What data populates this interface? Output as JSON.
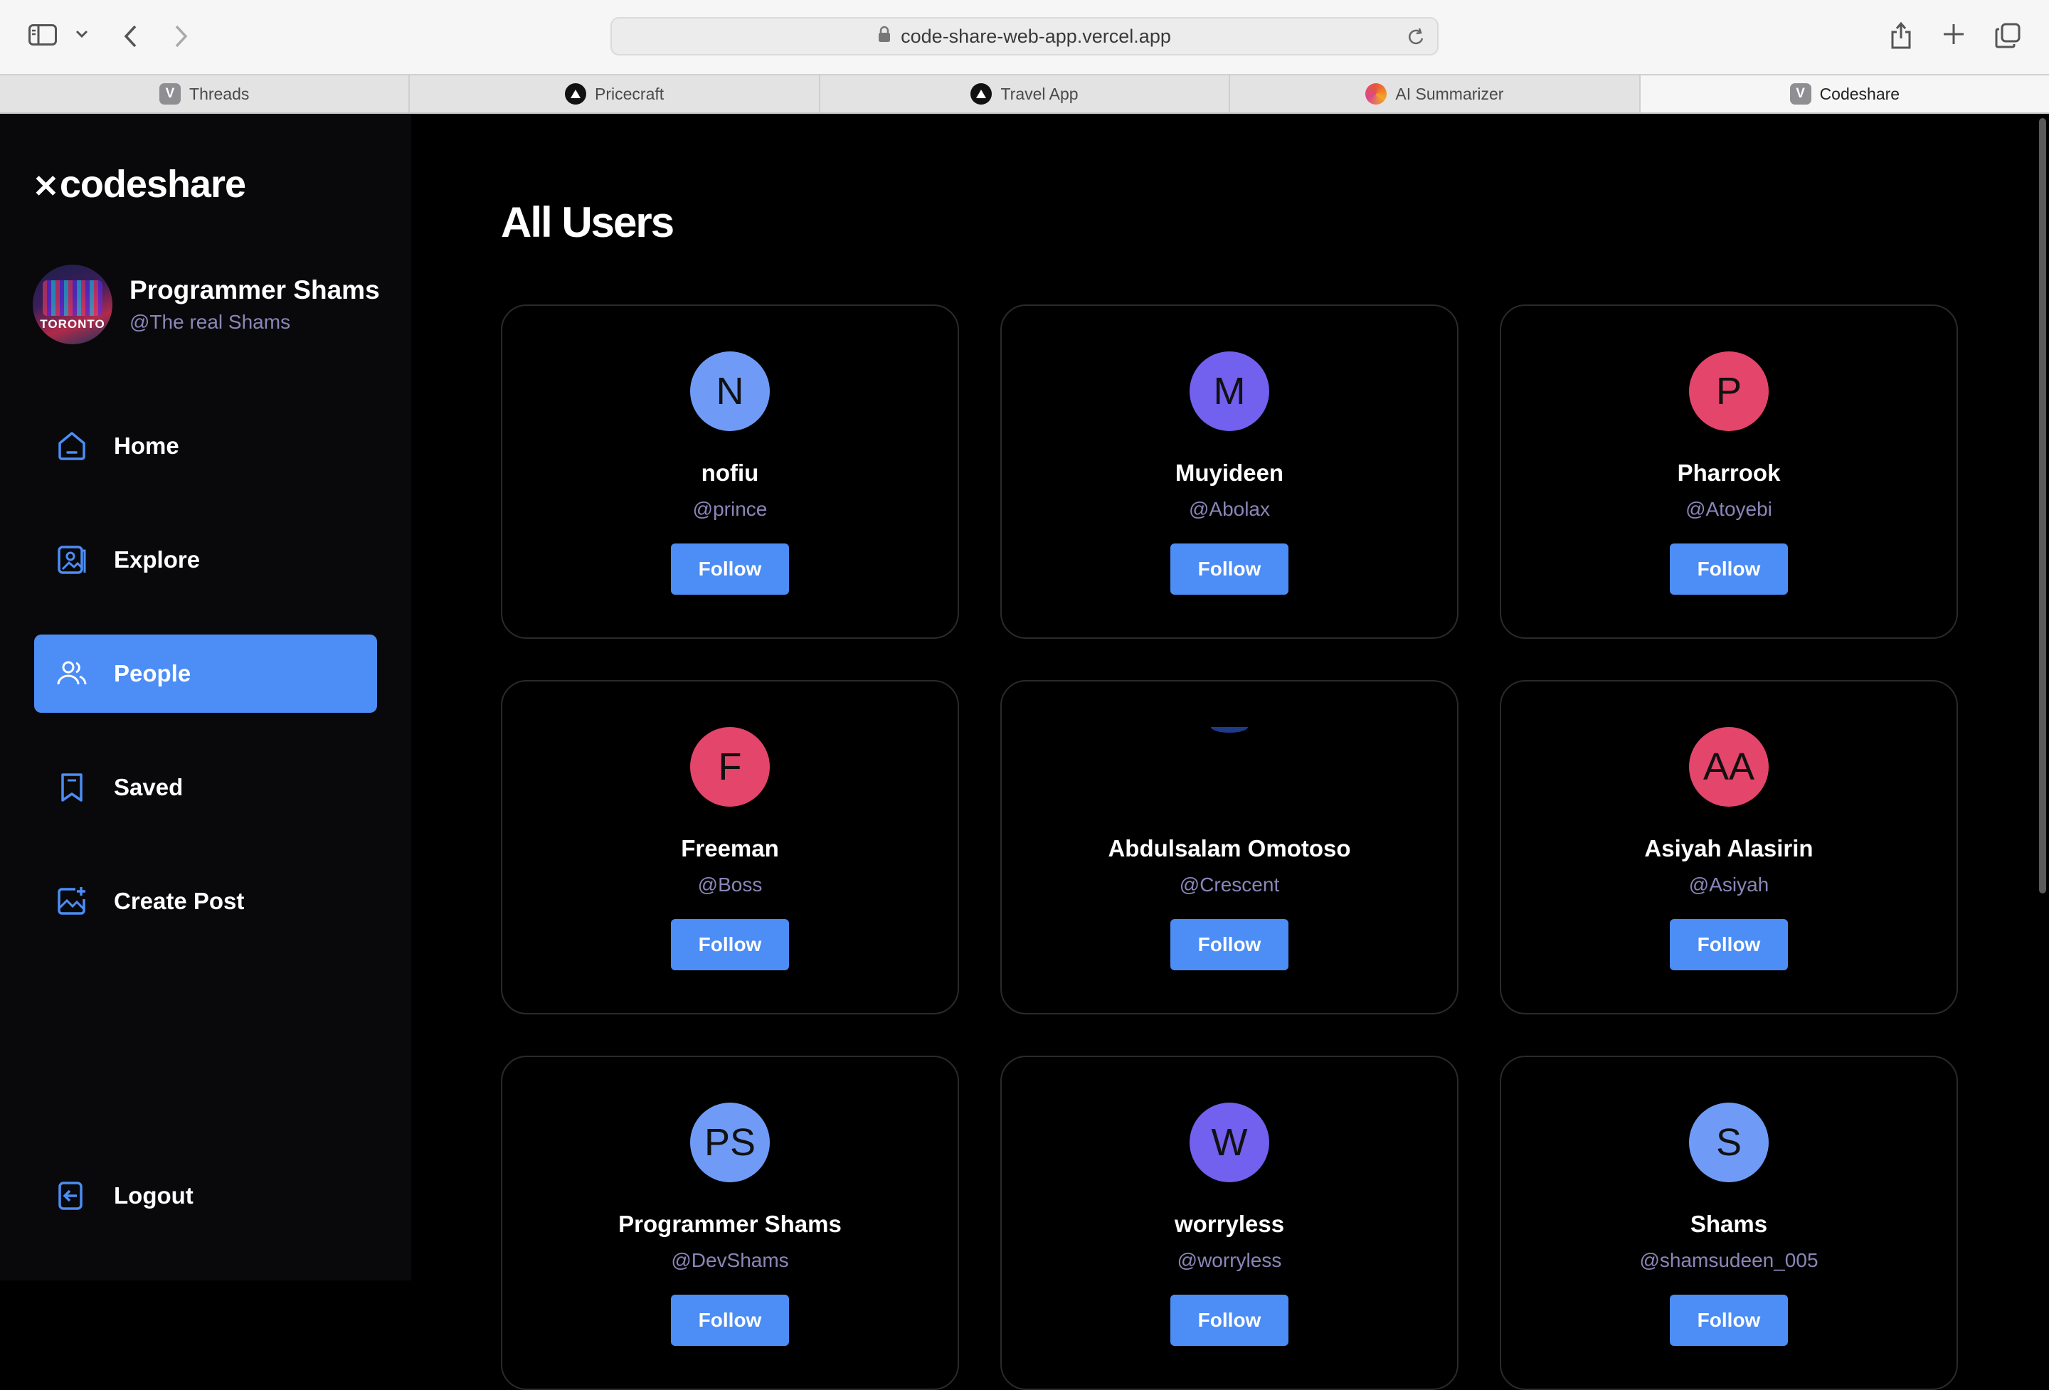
{
  "browser": {
    "url": "code-share-web-app.vercel.app",
    "tabs": [
      {
        "label": "Threads",
        "favicon": "V",
        "favicon_kind": "v",
        "active": false
      },
      {
        "label": "Pricecraft",
        "favicon": "",
        "favicon_kind": "triangle",
        "active": false
      },
      {
        "label": "Travel App",
        "favicon": "",
        "favicon_kind": "triangle",
        "active": false
      },
      {
        "label": "AI Summarizer",
        "favicon": "",
        "favicon_kind": "ai",
        "active": false
      },
      {
        "label": "Codeshare",
        "favicon": "V",
        "favicon_kind": "v",
        "active": true
      }
    ]
  },
  "sidebar": {
    "logo": "codeshare",
    "logo_mark": "✕",
    "profile": {
      "name": "Programmer Shams",
      "handle": "@The real Shams",
      "avatar_text": "TORONTO"
    },
    "nav": [
      {
        "label": "Home",
        "icon": "home-icon",
        "active": false
      },
      {
        "label": "Explore",
        "icon": "explore-icon",
        "active": false
      },
      {
        "label": "People",
        "icon": "people-icon",
        "active": true
      },
      {
        "label": "Saved",
        "icon": "bookmark-icon",
        "active": false
      },
      {
        "label": "Create Post",
        "icon": "create-post-icon",
        "active": false
      }
    ],
    "logout": "Logout"
  },
  "main": {
    "title": "All Users",
    "users": [
      {
        "initials": "N",
        "name": "nofiu",
        "handle": "@prince",
        "color": "#6f9bf7",
        "follow": "Follow"
      },
      {
        "initials": "M",
        "name": "Muyideen",
        "handle": "@Abolax",
        "color": "#7260ee",
        "follow": "Follow"
      },
      {
        "initials": "P",
        "name": "Pharrook",
        "handle": "@Atoyebi",
        "color": "#e4456a",
        "follow": "Follow"
      },
      {
        "initials": "F",
        "name": "Freeman",
        "handle": "@Boss",
        "color": "#e4456a",
        "follow": "Follow"
      },
      {
        "initials": "",
        "name": "Abdulsalam Omotoso",
        "handle": "@Crescent",
        "color": "",
        "photo": true,
        "follow": "Follow"
      },
      {
        "initials": "AA",
        "name": "Asiyah Alasirin",
        "handle": "@Asiyah",
        "color": "#e4456a",
        "follow": "Follow"
      },
      {
        "initials": "PS",
        "name": "Programmer Shams",
        "handle": "@DevShams",
        "color": "#6f9bf7",
        "follow": "Follow"
      },
      {
        "initials": "W",
        "name": "worryless",
        "handle": "@worryless",
        "color": "#7260ee",
        "follow": "Follow"
      },
      {
        "initials": "S",
        "name": "Shams",
        "handle": "@shamsudeen_005",
        "color": "#6f9bf7",
        "follow": "Follow"
      }
    ]
  },
  "colors": {
    "accent": "#4c8df6",
    "sidebar_bg": "#09090b",
    "handle": "#8a86b8"
  }
}
